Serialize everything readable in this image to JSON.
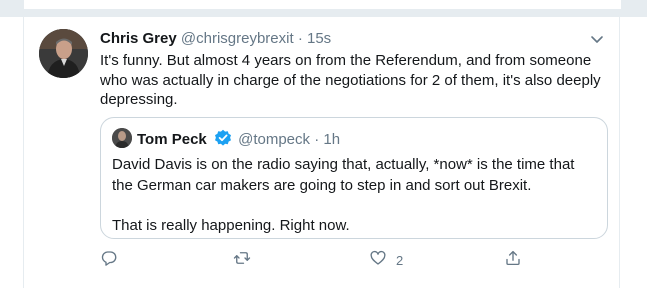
{
  "tweet": {
    "author_name": "Chris Grey",
    "author_handle": "@chrisgreybrexit",
    "separator": "·",
    "time": "15s",
    "text": "It's funny. But almost 4 years on from the Referendum, and from someone who was actually in charge of the negotiations for 2 of them, it's also deeply depressing."
  },
  "quoted": {
    "author_name": "Tom Peck",
    "author_handle": "@tompeck",
    "separator": "·",
    "time": "1h",
    "verified": true,
    "paragraphs": [
      "David Davis is on the radio saying that, actually, *now* is the time that the German car makers are going to step in and sort out Brexit.",
      "That is really happening. Right now."
    ]
  },
  "actions": {
    "reply_count": "",
    "retweet_count": "",
    "like_count": "2",
    "share_count": ""
  },
  "icons": [
    "caret-down-icon",
    "verified-badge-icon",
    "reply-icon",
    "retweet-icon",
    "like-icon",
    "share-icon"
  ],
  "colors": {
    "text": "#14171a",
    "secondary_text": "#657786",
    "verified": "#1da1f2",
    "border": "#e6ecf0",
    "quote_border": "#ccd6dd"
  }
}
